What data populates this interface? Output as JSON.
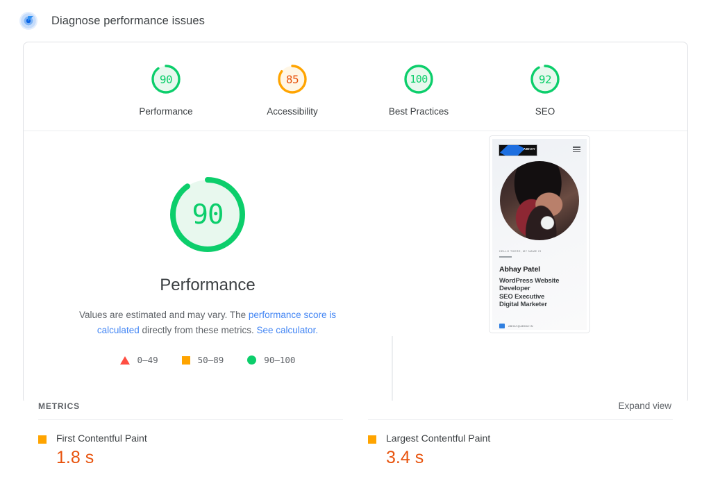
{
  "header": {
    "icon": "spark-diagnose-icon",
    "title": "Diagnose performance issues"
  },
  "categories": [
    {
      "label": "Performance",
      "score": "90",
      "value": 90,
      "color": "#0cce6b",
      "track": "#e8f8ee",
      "text_color": "#0cce6b"
    },
    {
      "label": "Accessibility",
      "score": "85",
      "value": 85,
      "color": "#ffa400",
      "track": "#fff6e5",
      "text_color": "#e8530d"
    },
    {
      "label": "Best Practices",
      "score": "100",
      "value": 100,
      "color": "#0cce6b",
      "track": "#e8f8ee",
      "text_color": "#0cce6b"
    },
    {
      "label": "SEO",
      "score": "92",
      "value": 92,
      "color": "#0cce6b",
      "track": "#e8f8ee",
      "text_color": "#0cce6b"
    }
  ],
  "performance": {
    "score": "90",
    "value": 90,
    "title": "Performance",
    "desc_part1": "Values are estimated and may vary. The ",
    "link1": "performance score is calculated",
    "desc_part2": " directly from these metrics. ",
    "link2": "See calculator.",
    "legend": [
      {
        "symbol": "triangle",
        "range": "0–49",
        "color": "#ff4e42"
      },
      {
        "symbol": "square",
        "range": "50–89",
        "color": "#ffa400"
      },
      {
        "symbol": "circle",
        "range": "90–100",
        "color": "#0cce6b"
      }
    ]
  },
  "thumbnail": {
    "logo_text": "ABHAY",
    "menu_icon": "hamburger-menu-icon",
    "kicker": "HELLO THERE, MY NAME IS",
    "name": "Abhay Patel",
    "roles": "WordPress Website\nDeveloper\nSEO Executive\nDigital Marketer",
    "footer_text": "ABHAY@ABHAY.IN"
  },
  "metrics": {
    "section_title": "METRICS",
    "expand_label": "Expand view",
    "items": [
      {
        "name": "First Contentful Paint",
        "value": "1.8 s",
        "status_color": "#ffa400"
      },
      {
        "name": "Largest Contentful Paint",
        "value": "3.4 s",
        "status_color": "#ffa400"
      }
    ]
  }
}
